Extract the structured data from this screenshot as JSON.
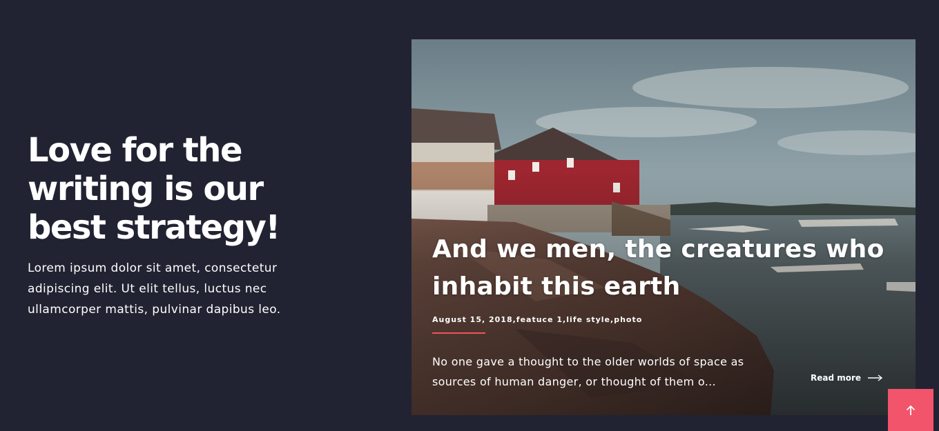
{
  "intro": {
    "headline": "Love for the writing is our best strategy!",
    "body": "Lorem ipsum dolor sit amet, consectetur adipiscing elit. Ut elit tellus, luctus nec ullamcorper mattis, pulvinar dapibus leo."
  },
  "post": {
    "title": "And we men, the creatures who inhabit this earth",
    "meta": "August 15, 2018,featuce 1,life style,photo",
    "excerpt": "No one gave a thought to the older worlds of space as sources of human danger, or thought of them o...",
    "read_more": "Read more",
    "image_subject": "harbor with red wooden building, rocky shore and boats"
  },
  "colors": {
    "background": "#212332",
    "accent": "#f2545b",
    "scroll_button": "#f2546b"
  },
  "icons": {
    "read_more": "arrow-right-icon",
    "scroll_top": "arrow-up-icon"
  }
}
